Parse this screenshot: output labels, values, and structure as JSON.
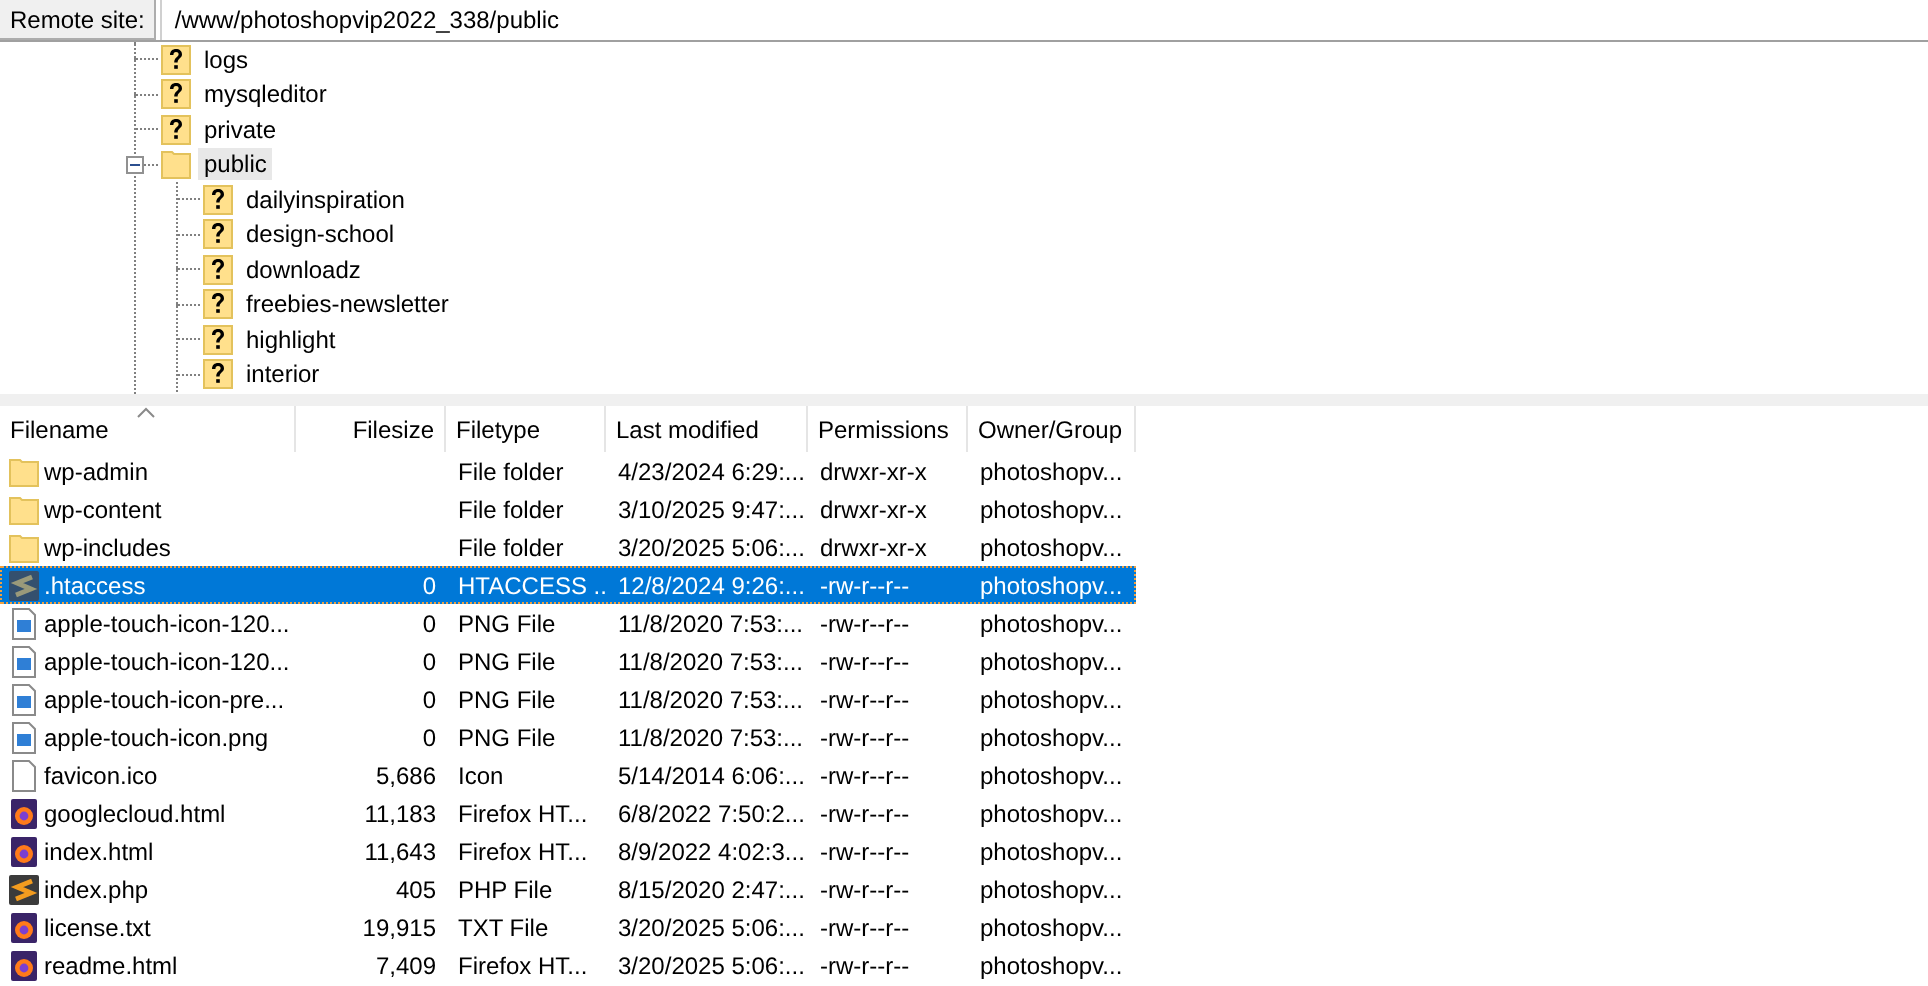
{
  "remote_site": {
    "label": "Remote site:",
    "path": "/www/photoshopvip2022_338/public"
  },
  "tree": [
    {
      "name": "logs",
      "kind": "unknown",
      "selected": false
    },
    {
      "name": "mysqleditor",
      "kind": "unknown",
      "selected": false
    },
    {
      "name": "private",
      "kind": "unknown",
      "selected": false
    },
    {
      "name": "public",
      "kind": "folder",
      "selected": true,
      "expanded": true,
      "children": [
        {
          "name": "dailyinspiration",
          "kind": "unknown",
          "selected": false
        },
        {
          "name": "design-school",
          "kind": "unknown",
          "selected": false
        },
        {
          "name": "downloadz",
          "kind": "unknown",
          "selected": false
        },
        {
          "name": "freebies-newsletter",
          "kind": "unknown",
          "selected": false
        },
        {
          "name": "highlight",
          "kind": "unknown",
          "selected": false
        },
        {
          "name": "interior",
          "kind": "unknown",
          "selected": false
        }
      ]
    }
  ],
  "files": {
    "columns": [
      {
        "label": "Filename",
        "sorted": true
      },
      {
        "label": "Filesize",
        "sorted": false
      },
      {
        "label": "Filetype",
        "sorted": false
      },
      {
        "label": "Last modified",
        "sorted": false
      },
      {
        "label": "Permissions",
        "sorted": false
      },
      {
        "label": "Owner/Group",
        "sorted": false
      }
    ],
    "rows": [
      {
        "kind": "folder",
        "selected": false,
        "cells": [
          "wp-admin",
          "",
          "File folder",
          "4/23/2024 6:29:...",
          "drwxr-xr-x",
          "photoshopv..."
        ]
      },
      {
        "kind": "folder",
        "selected": false,
        "cells": [
          "wp-content",
          "",
          "File folder",
          "3/10/2025 9:47:...",
          "drwxr-xr-x",
          "photoshopv..."
        ]
      },
      {
        "kind": "folder",
        "selected": false,
        "cells": [
          "wp-includes",
          "",
          "File folder",
          "3/20/2025 5:06:...",
          "drwxr-xr-x",
          "photoshopv..."
        ]
      },
      {
        "kind": "script",
        "selected": true,
        "cells": [
          ".htaccess",
          "0",
          "HTACCESS ...",
          "12/8/2024 9:26:...",
          "-rw-r--r--",
          "photoshopv..."
        ]
      },
      {
        "kind": "image",
        "selected": false,
        "cells": [
          "apple-touch-icon-120...",
          "0",
          "PNG File",
          "11/8/2020 7:53:...",
          "-rw-r--r--",
          "photoshopv..."
        ]
      },
      {
        "kind": "image",
        "selected": false,
        "cells": [
          "apple-touch-icon-120...",
          "0",
          "PNG File",
          "11/8/2020 7:53:...",
          "-rw-r--r--",
          "photoshopv..."
        ]
      },
      {
        "kind": "image",
        "selected": false,
        "cells": [
          "apple-touch-icon-pre...",
          "0",
          "PNG File",
          "11/8/2020 7:53:...",
          "-rw-r--r--",
          "photoshopv..."
        ]
      },
      {
        "kind": "image",
        "selected": false,
        "cells": [
          "apple-touch-icon.png",
          "0",
          "PNG File",
          "11/8/2020 7:53:...",
          "-rw-r--r--",
          "photoshopv..."
        ]
      },
      {
        "kind": "blank",
        "selected": false,
        "cells": [
          "favicon.ico",
          "5,686",
          "Icon",
          "5/14/2014 6:06:...",
          "-rw-r--r--",
          "photoshopv..."
        ]
      },
      {
        "kind": "browser",
        "selected": false,
        "cells": [
          "googlecloud.html",
          "11,183",
          "Firefox HT...",
          "6/8/2022 7:50:2...",
          "-rw-r--r--",
          "photoshopv..."
        ]
      },
      {
        "kind": "browser",
        "selected": false,
        "cells": [
          "index.html",
          "11,643",
          "Firefox HT...",
          "8/9/2022 4:02:3...",
          "-rw-r--r--",
          "photoshopv..."
        ]
      },
      {
        "kind": "script",
        "selected": false,
        "cells": [
          "index.php",
          "405",
          "PHP File",
          "8/15/2020 2:47:...",
          "-rw-r--r--",
          "photoshopv..."
        ]
      },
      {
        "kind": "browser",
        "selected": false,
        "cells": [
          "license.txt",
          "19,915",
          "TXT File",
          "3/20/2025 5:06:...",
          "-rw-r--r--",
          "photoshopv..."
        ]
      },
      {
        "kind": "browser",
        "selected": false,
        "cells": [
          "readme.html",
          "7,409",
          "Firefox HT...",
          "3/20/2025 5:06:...",
          "-rw-r--r--",
          "photoshopv..."
        ]
      }
    ]
  }
}
